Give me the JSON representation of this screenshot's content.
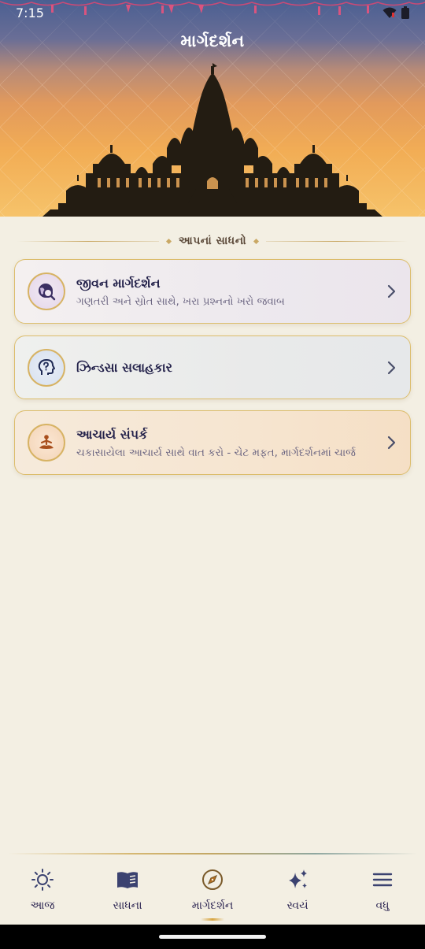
{
  "status_bar": {
    "time": "7:15"
  },
  "header": {
    "title": "માર્ગદર્શન"
  },
  "section": {
    "heading": "આપનાં સાધનો"
  },
  "cards": [
    {
      "title": "જીવન માર્ગદર્શન",
      "subtitle": "ગણતરી અને સ્રોત સાથે, ખરા પ્રશ્નનો ખરો જવાબ",
      "icon": "globe-search-icon"
    },
    {
      "title": "ઝિન્ડસા સલાહકાર",
      "subtitle": "",
      "icon": "head-question-icon"
    },
    {
      "title": "આચાર્ય સંપર્ક",
      "subtitle": "ચકાસાયેલા આચાર્ય સાથે વાત કરો - ચેટ મફત, માર્ગદર્શનમાં ચાર્જ",
      "icon": "meditation-icon"
    }
  ],
  "nav": {
    "items": [
      {
        "label": "આજ",
        "icon": "sun-icon"
      },
      {
        "label": "સાધના",
        "icon": "book-icon"
      },
      {
        "label": "માર્ગદર્શન",
        "icon": "compass-icon",
        "active": true
      },
      {
        "label": "સ્વયં",
        "icon": "sparkles-icon"
      },
      {
        "label": "વધુ",
        "icon": "menu-icon"
      }
    ]
  },
  "colors": {
    "accent_gold": "#d7b364",
    "text_dark": "#23214a",
    "background": "#f3efe3"
  }
}
